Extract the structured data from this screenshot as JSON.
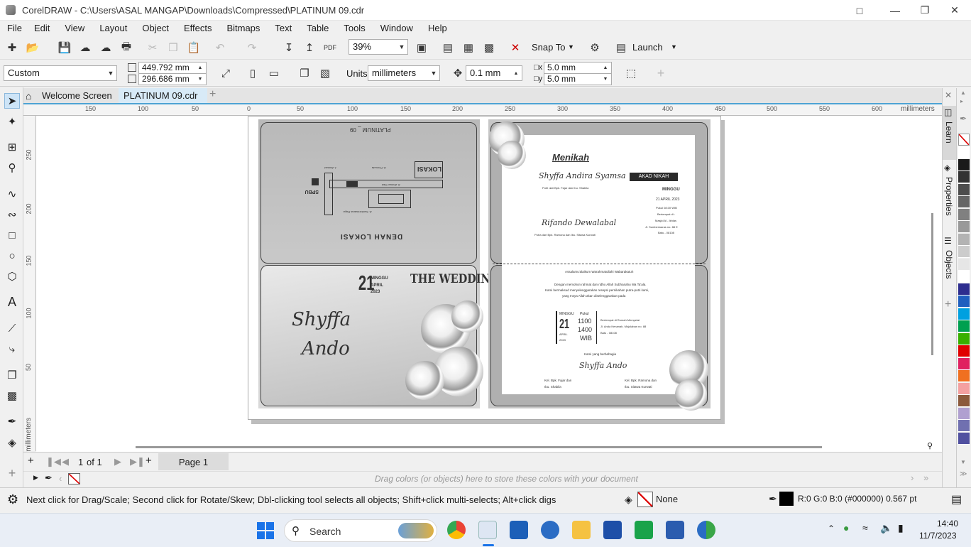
{
  "window": {
    "title": "CorelDRAW - C:\\Users\\ASAL MANGAP\\Downloads\\Compressed\\PLATINUM 09.cdr"
  },
  "menu": [
    "File",
    "Edit",
    "View",
    "Layout",
    "Object",
    "Effects",
    "Bitmaps",
    "Text",
    "Table",
    "Tools",
    "Window",
    "Help"
  ],
  "toolbar": {
    "zoom": "39%",
    "snap_label": "Snap To",
    "launch_label": "Launch"
  },
  "property_bar": {
    "page_size": "Custom",
    "width": "449.792 mm",
    "height": "296.686 mm",
    "units_label": "Units:",
    "units_value": "millimeters",
    "nudge": "0.1 mm",
    "dup_x": "5.0 mm",
    "dup_y": "5.0 mm"
  },
  "tabs": {
    "welcome": "Welcome Screen",
    "document": "PLATINUM 09.cdr"
  },
  "ruler": {
    "h_labels": [
      "150",
      "100",
      "50",
      "0",
      "50",
      "100",
      "150",
      "200",
      "250",
      "300",
      "350",
      "400",
      "450",
      "500",
      "550",
      "600"
    ],
    "unit": "millimeters",
    "v_labels": [
      "250",
      "200",
      "150",
      "100",
      "50"
    ],
    "v_unit": "millimeters"
  },
  "page_nav": {
    "current": "1",
    "of_label": "of 1",
    "page_tab": "Page 1"
  },
  "doc_palette_hint": "Drag colors (or objects) here to store these colors with your document",
  "dockers": {
    "learn": "Learn",
    "properties": "Properties",
    "objects": "Objects"
  },
  "palette_colors": [
    "#ffffff",
    "#1a1a1a",
    "#333333",
    "#4d4d4d",
    "#666666",
    "#808080",
    "#999999",
    "#b3b3b3",
    "#cccccc",
    "#e6e6e6",
    "#ffffff",
    "#2d2d8f",
    "#1f5fbf",
    "#00a0e0",
    "#00a050",
    "#38b000",
    "#e00000",
    "#e02060",
    "#f07020",
    "#f4a0a0",
    "#8c5a3c",
    "#b0a0d0",
    "#7070b0",
    "#5050a0"
  ],
  "status": {
    "hint": "Next click for Drag/Scale; Second click for Rotate/Skew; Dbl-clicking tool selects all objects; Shift+click multi-selects; Alt+click digs",
    "fill_label": "None",
    "outline_info": "R:0 G:0 B:0 (#000000)  0.567 pt"
  },
  "taskbar": {
    "search_label": "Search",
    "time": "14:40",
    "date": "11/7/2023"
  },
  "design": {
    "platinum_label": "PLATINUM _ 09",
    "map_title": "DENAH LOKASI",
    "map_lokasi": "LOKASI",
    "map_spbu": "SPBU",
    "day_number": "21",
    "date_lines": [
      "MINGGU",
      "APRIL",
      "2023"
    ],
    "wedding_title": "THE WEDDING",
    "bride": "Shyffa",
    "groom": "Ando",
    "menikah": "Menikah",
    "bride_full": "Shyffa Andira Syamsa",
    "bride_parents": "Putri dari Bpk. Fajar dan Ibu. Shabila",
    "groom_full": "Rifando Dewalabal",
    "groom_parents": "Putra dari Bpk. Ramona dan Ibu. Sitawa Kurwati",
    "akad_label": "AKAD NIKAH",
    "akad_day": "MINGGU",
    "akad_date": "21 APRIL 2023",
    "akad_time": "Pukul 08.00 WIB",
    "akad_place": [
      "Bertempat di :",
      "Masjid Al - Ikhlas",
      "Jl. Sumberwaras no. 88 E",
      "Batu - 08108"
    ],
    "greeting": "Assalamu'alaikum Warahmatullahi Wabarakatuh",
    "body_lines": [
      "Dengan memohon rahmat dan ridho Allah Subhanahu Wa Ta'ala.",
      "Kami bermaksud menyelenggarakan resepsi pernikahan putra-putri kami,",
      "yang Insya Allah akan diselenggarakan pada"
    ],
    "recept_day": "MINGGU",
    "recept_num": "21",
    "recept_month": "APRIL",
    "recept_year": "2023",
    "recept_pukul": "Pukul",
    "recept_times": [
      "1100",
      "1400",
      "WIB"
    ],
    "recept_place": [
      "Bertempat di Rumah Mempelai",
      "Jl. Anda Kenanah, Mojolaban no. 88",
      "Batu - 08108"
    ],
    "closing": "Kami yang berbahagia",
    "sign_names": "Shyffa  Ando",
    "family_left": [
      "Kel. Bpk. Fajar dan",
      "Ibu. Shabila"
    ],
    "family_right": [
      "Kel. Bpk. Ramona dan",
      "Ibu. Sitawa Kurwati"
    ],
    "map_streets": [
      "Jl. Sumberwaras Raya",
      "Jl. Ahmad Yani",
      "Jl. Pemuda",
      "J. Ahmad"
    ]
  }
}
